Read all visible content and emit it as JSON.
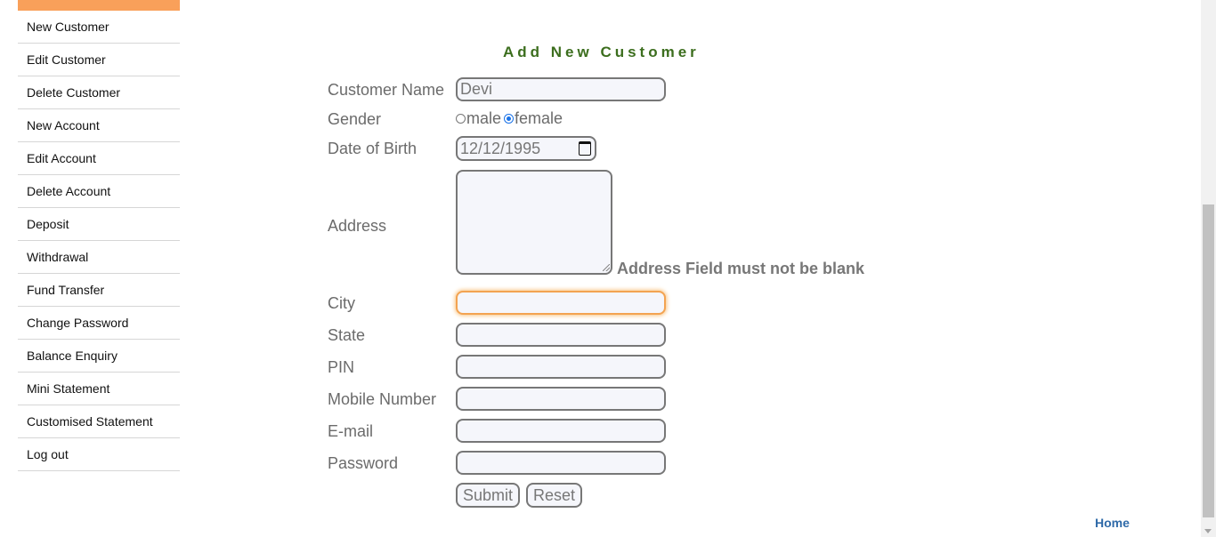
{
  "sidebar": {
    "items": [
      {
        "label": "New Customer"
      },
      {
        "label": "Edit Customer"
      },
      {
        "label": "Delete Customer"
      },
      {
        "label": "New Account"
      },
      {
        "label": "Edit Account"
      },
      {
        "label": "Delete Account"
      },
      {
        "label": "Deposit"
      },
      {
        "label": "Withdrawal"
      },
      {
        "label": "Fund Transfer"
      },
      {
        "label": "Change Password"
      },
      {
        "label": "Balance Enquiry"
      },
      {
        "label": "Mini Statement"
      },
      {
        "label": "Customised Statement"
      },
      {
        "label": "Log out"
      }
    ]
  },
  "form": {
    "title": "Add New Customer",
    "labels": {
      "customer_name": "Customer Name",
      "gender": "Gender",
      "dob": "Date of Birth",
      "address": "Address",
      "city": "City",
      "state": "State",
      "pin": "PIN",
      "mobile": "Mobile Number",
      "email": "E-mail",
      "password": "Password"
    },
    "values": {
      "customer_name": "Devi",
      "dob": "12/12/1995",
      "address": "",
      "city": "",
      "state": "",
      "pin": "",
      "mobile": "",
      "email": "",
      "password": ""
    },
    "gender_options": {
      "male": "male",
      "female": "female",
      "selected": "female"
    },
    "address_error": "Address Field must not be blank",
    "submit_label": "Submit",
    "reset_label": "Reset"
  },
  "footer": {
    "home_link": "Home"
  },
  "colors": {
    "accent": "#f9a05a",
    "title": "#3c6e1e",
    "link": "#2f6aa8",
    "radio": "#1a73e8"
  }
}
